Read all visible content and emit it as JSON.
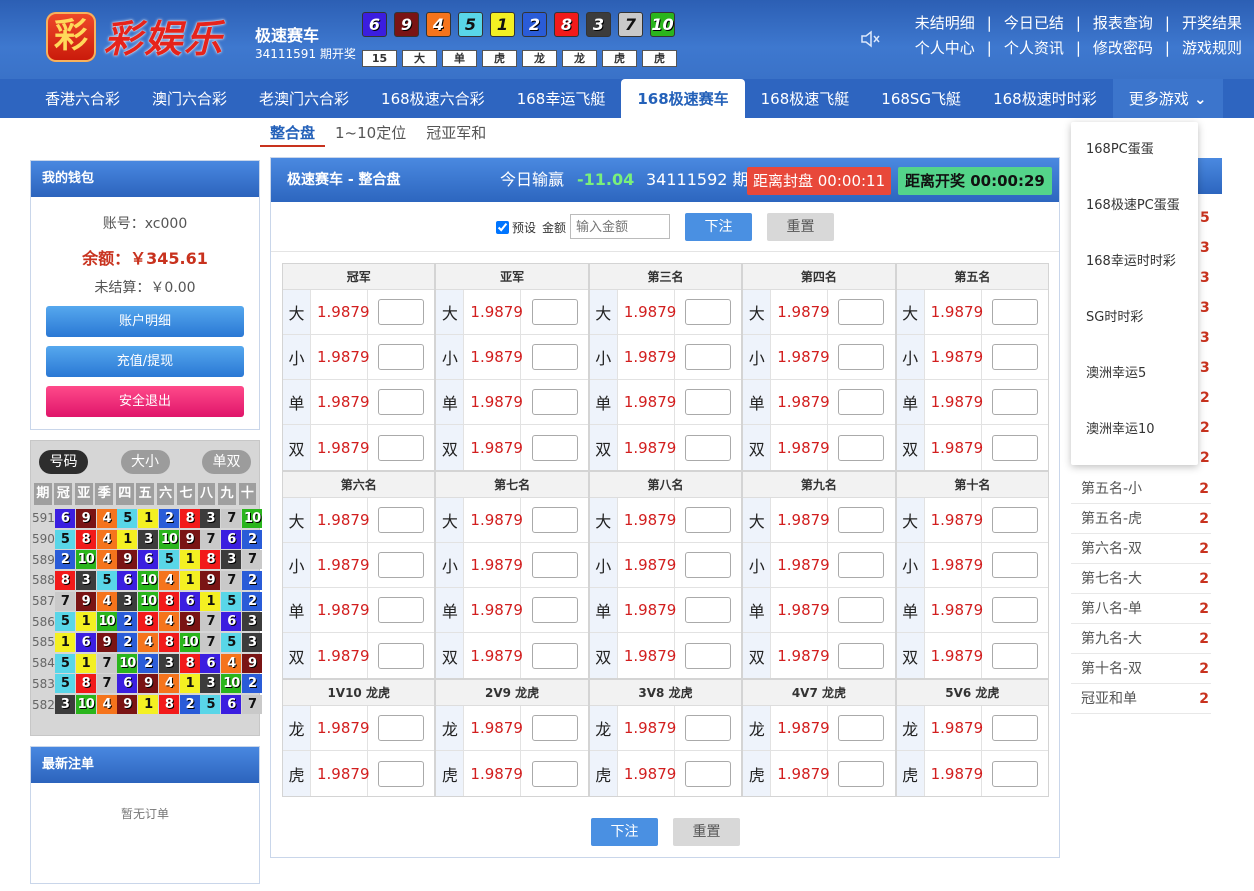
{
  "header": {
    "logo_mark": "彩",
    "logo_text": "彩娱乐",
    "game_title": "极速赛车",
    "game_issue": "34111591 期开奖",
    "balls": [
      {
        "n": "6",
        "c": "#3b1ee0",
        "light": false
      },
      {
        "n": "9",
        "c": "#7a1414",
        "light": false
      },
      {
        "n": "4",
        "c": "#f5741c",
        "light": false
      },
      {
        "n": "5",
        "c": "#59d6e8",
        "light": true
      },
      {
        "n": "1",
        "c": "#f4f022",
        "light": true
      },
      {
        "n": "2",
        "c": "#2a5cd8",
        "light": false
      },
      {
        "n": "8",
        "c": "#f21a1a",
        "light": false
      },
      {
        "n": "3",
        "c": "#3c3c3c",
        "light": false
      },
      {
        "n": "7",
        "c": "#c9c9c9",
        "light": true
      },
      {
        "n": "10",
        "c": "#2ab51c",
        "light": false
      }
    ],
    "tags": [
      "15",
      "大",
      "单",
      "虎",
      "龙",
      "龙",
      "虎",
      "虎"
    ],
    "links_row1": [
      "未结明细",
      "今日已结",
      "报表查询",
      "开奖结果"
    ],
    "links_row2": [
      "个人中心",
      "个人资讯",
      "修改密码",
      "游戏规则"
    ]
  },
  "nav": {
    "items": [
      "香港六合彩",
      "澳门六合彩",
      "老澳门六合彩",
      "168极速六合彩",
      "168幸运飞艇",
      "168极速赛车",
      "168极速飞艇",
      "168SG飞艇",
      "168极速时时彩",
      "更多游戏"
    ],
    "active_index": 5
  },
  "subtabs": [
    "整合盘",
    "1~10定位",
    "冠亚军和"
  ],
  "wallet": {
    "title": "我的钱包",
    "account": "账号：xc000",
    "balance": "余额：￥345.61",
    "unsettled": "未结算：￥0.00",
    "btn_detail": "账户明细",
    "btn_deposit": "充值/提现",
    "btn_logout": "安全退出"
  },
  "history": {
    "tabs": [
      "号码",
      "大小",
      "单双"
    ],
    "head": [
      "期",
      "冠",
      "亚",
      "季",
      "四",
      "五",
      "六",
      "七",
      "八",
      "九",
      "十"
    ],
    "colors": {
      "1": "#f4f022",
      "2": "#2a5cd8",
      "3": "#3c3c3c",
      "4": "#f5741c",
      "5": "#59d6e8",
      "6": "#3b1ee0",
      "7": "#c9c9c9",
      "8": "#f21a1a",
      "9": "#7a1414",
      "10": "#2ab51c"
    },
    "rows": [
      {
        "i": "591",
        "n": [
          "6",
          "9",
          "4",
          "5",
          "1",
          "2",
          "8",
          "3",
          "7",
          "10"
        ]
      },
      {
        "i": "590",
        "n": [
          "5",
          "8",
          "4",
          "1",
          "3",
          "10",
          "9",
          "7",
          "6",
          "2"
        ]
      },
      {
        "i": "589",
        "n": [
          "2",
          "10",
          "4",
          "9",
          "6",
          "5",
          "1",
          "8",
          "3",
          "7"
        ]
      },
      {
        "i": "588",
        "n": [
          "8",
          "3",
          "5",
          "6",
          "10",
          "4",
          "1",
          "9",
          "7",
          "2"
        ]
      },
      {
        "i": "587",
        "n": [
          "7",
          "9",
          "4",
          "3",
          "10",
          "8",
          "6",
          "1",
          "5",
          "2"
        ]
      },
      {
        "i": "586",
        "n": [
          "5",
          "1",
          "10",
          "2",
          "8",
          "4",
          "9",
          "7",
          "6",
          "3"
        ]
      },
      {
        "i": "585",
        "n": [
          "1",
          "6",
          "9",
          "2",
          "4",
          "8",
          "10",
          "7",
          "5",
          "3"
        ]
      },
      {
        "i": "584",
        "n": [
          "5",
          "1",
          "7",
          "10",
          "2",
          "3",
          "8",
          "6",
          "4",
          "9"
        ]
      },
      {
        "i": "583",
        "n": [
          "5",
          "8",
          "7",
          "6",
          "9",
          "4",
          "1",
          "3",
          "10",
          "2"
        ]
      },
      {
        "i": "582",
        "n": [
          "3",
          "10",
          "4",
          "9",
          "1",
          "8",
          "2",
          "5",
          "6",
          "7"
        ]
      }
    ]
  },
  "latest": {
    "title": "最新注单",
    "empty": "暂无订单"
  },
  "main": {
    "title": "极速赛车 - 整合盘",
    "winlose_label": "今日输赢",
    "winlose_value": "-11.04",
    "issue": "34111592 期",
    "close_label": "距离封盘 00:00:11",
    "open_label": "距离开奖 00:00:29",
    "preset_label": "预设",
    "amount_label": "金额",
    "amount_placeholder": "输入金额",
    "bet_label": "下注",
    "reset_label": "重置",
    "odds": "1.9879",
    "sections": [
      {
        "cols": [
          "冠军",
          "亚军",
          "第三名",
          "第四名",
          "第五名"
        ],
        "labels": [
          "大",
          "小",
          "单",
          "双"
        ]
      },
      {
        "cols": [
          "第六名",
          "第七名",
          "第八名",
          "第九名",
          "第十名"
        ],
        "labels": [
          "大",
          "小",
          "单",
          "双"
        ]
      },
      {
        "cols": [
          "1V10 龙虎",
          "2V9 龙虎",
          "3V8 龙虎",
          "4V7 龙虎",
          "5V6 龙虎"
        ],
        "labels": [
          "龙",
          "虎"
        ]
      }
    ]
  },
  "more_menu": [
    "168PC蛋蛋",
    "168极速PC蛋蛋",
    "168幸运时时彩",
    "SG时时彩",
    "澳洲幸运5",
    "澳洲幸运10"
  ],
  "right_panel": {
    "hidden_values": [
      "5",
      "3",
      "3",
      "3",
      "3",
      "3",
      "2",
      "2",
      "2"
    ],
    "rows": [
      {
        "k": "第五名-小",
        "v": "2"
      },
      {
        "k": "第五名-虎",
        "v": "2"
      },
      {
        "k": "第六名-双",
        "v": "2"
      },
      {
        "k": "第七名-大",
        "v": "2"
      },
      {
        "k": "第八名-单",
        "v": "2"
      },
      {
        "k": "第九名-大",
        "v": "2"
      },
      {
        "k": "第十名-双",
        "v": "2"
      },
      {
        "k": "冠亚和单",
        "v": "2"
      }
    ]
  }
}
